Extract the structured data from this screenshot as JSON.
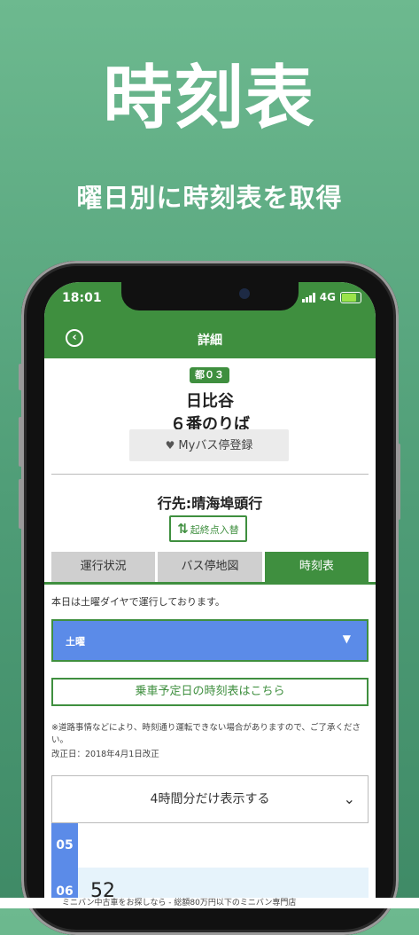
{
  "promo": {
    "title": "時刻表",
    "subtitle": "曜日別に時刻表を取得"
  },
  "status_bar": {
    "time": "18:01",
    "network": "4G"
  },
  "nav": {
    "title": "詳細"
  },
  "stop": {
    "route_badge": "都０３",
    "name": "日比谷",
    "platform": "６番のりば",
    "my_stop_button": "Myバス停登録"
  },
  "destination": {
    "label": "行先:晴海埠頭行",
    "swap_button": "起終点入替"
  },
  "tabs": [
    {
      "label": "運行状況",
      "active": false
    },
    {
      "label": "バス停地図",
      "active": false
    },
    {
      "label": "時刻表",
      "active": true
    }
  ],
  "timetable": {
    "notice": "本日は土曜ダイヤで運行しております。",
    "day_selected": "土曜",
    "planned_date_link": "乗車予定日の時刻表はこちら",
    "note": "※道路事情などにより、時刻通り運転できない場合がありますので、ご了承ください。",
    "revised": "改正日：2018年4月1日改正",
    "hours_toggle": "4時間分だけ表示する",
    "rows": [
      {
        "hour": "05",
        "minutes": ""
      },
      {
        "hour": "06",
        "minutes": "52"
      }
    ]
  },
  "ad": {
    "text": "ミニバン中古車をお探しなら - 総額80万円以下のミニバン専門店"
  },
  "colors": {
    "brand_green": "#3f8f3f",
    "select_blue": "#5b8be8",
    "background_green": "#5aa882"
  },
  "icons": {
    "back": "chevron-left-circle-icon",
    "heart": "heart-icon",
    "swap": "swap-icon",
    "dropdown": "caret-down-icon",
    "expand": "chevron-down-icon"
  }
}
